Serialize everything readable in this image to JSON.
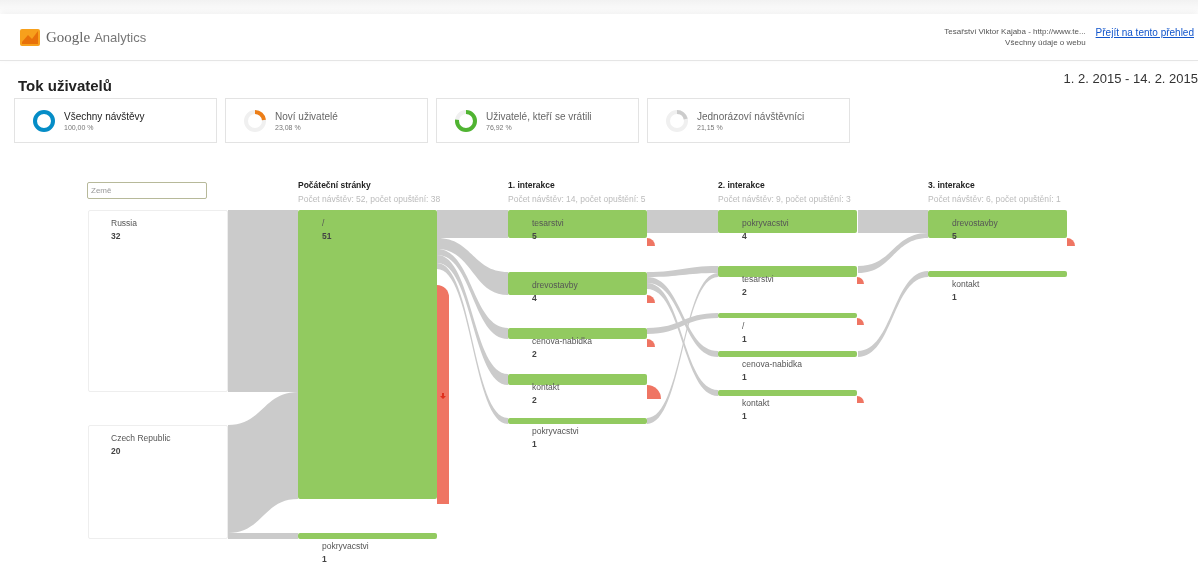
{
  "header": {
    "brand": "Google",
    "product": "Analytics",
    "account": "Tesařství Viktor Kajaba - http://www.te...",
    "view": "Všechny údaje o webu",
    "link": "Přejít na tento přehled"
  },
  "title": "Tok uživatelů",
  "date_range": "1. 2. 2015 - 14. 2. 2015",
  "segments": [
    {
      "label": "Všechny návštěvy",
      "value": "100,00 %",
      "selected": true,
      "color": "#058dc7"
    },
    {
      "label": "Noví uživatelé",
      "value": "23,08 %",
      "selected": false,
      "color": "#ed7e17"
    },
    {
      "label": "Uživatelé, kteří se vrátili",
      "value": "76,92 %",
      "selected": false,
      "color": "#50b432"
    },
    {
      "label": "Jednorázoví návštěvníci",
      "value": "21,15 %",
      "selected": false,
      "color": "#cccccc"
    }
  ],
  "flow": {
    "filter_placeholder": "Země",
    "countries": [
      {
        "name": "Russia",
        "count": "32"
      },
      {
        "name": "Czech Republic",
        "count": "20"
      }
    ],
    "columns": [
      {
        "title": "Počáteční stránky",
        "subtitle": "Počet návštěv: 52, počet opuštění: 38",
        "nodes": [
          {
            "name": "/",
            "count": "51"
          },
          {
            "name": "pokryvacstvi",
            "count": "1"
          }
        ]
      },
      {
        "title": "1. interakce",
        "subtitle": "Počet návštěv: 14, počet opuštění: 5",
        "nodes": [
          {
            "name": "tesarstvi",
            "count": "5"
          },
          {
            "name": "drevostavby",
            "count": "4"
          },
          {
            "name": "cenova-nabidka",
            "count": "2"
          },
          {
            "name": "kontakt",
            "count": "2"
          },
          {
            "name": "pokryvacstvi",
            "count": "1"
          }
        ]
      },
      {
        "title": "2. interakce",
        "subtitle": "Počet návštěv: 9, počet opuštění: 3",
        "nodes": [
          {
            "name": "pokryvacstvi",
            "count": "4"
          },
          {
            "name": "tesarstvi",
            "count": "2"
          },
          {
            "name": "/",
            "count": "1"
          },
          {
            "name": "cenova-nabidka",
            "count": "1"
          },
          {
            "name": "kontakt",
            "count": "1"
          }
        ]
      },
      {
        "title": "3. interakce",
        "subtitle": "Počet návštěv: 6, počet opuštění: 1",
        "nodes": [
          {
            "name": "drevostavby",
            "count": "5"
          },
          {
            "name": "kontakt",
            "count": "1"
          }
        ]
      }
    ]
  }
}
